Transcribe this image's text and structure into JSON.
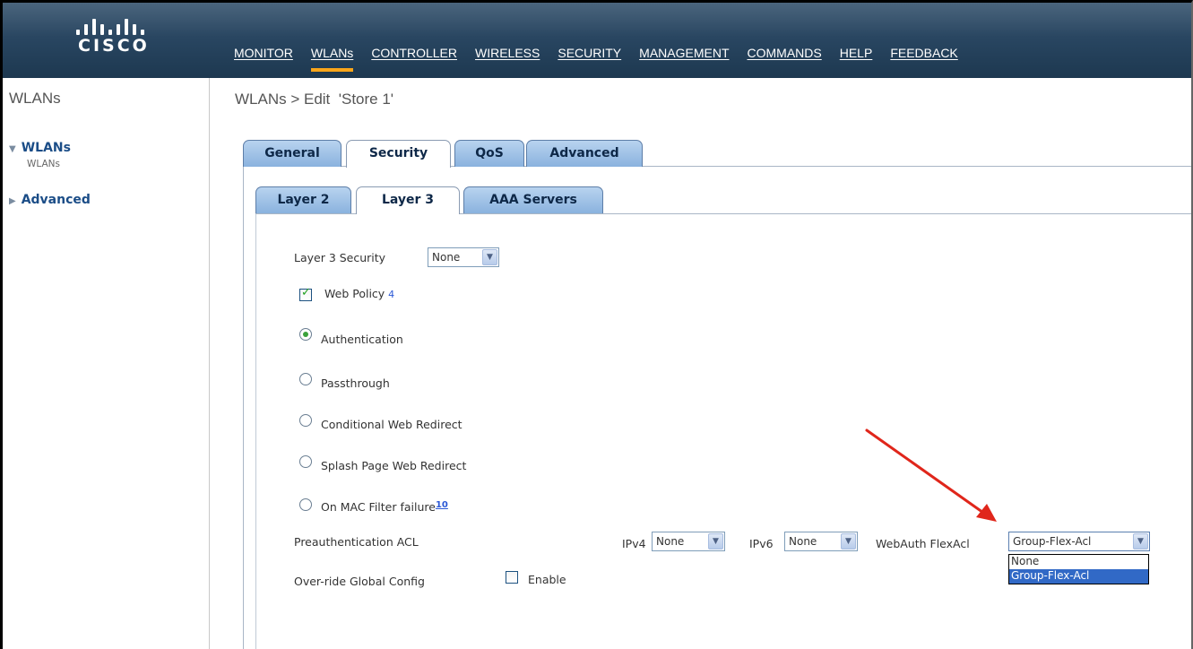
{
  "header": {
    "logo_text": "CISCO",
    "nav": [
      {
        "label": "MONITOR",
        "active": false
      },
      {
        "label": "WLANs",
        "active": true
      },
      {
        "label": "CONTROLLER",
        "active": false
      },
      {
        "label": "WIRELESS",
        "active": false
      },
      {
        "label": "SECURITY",
        "active": false
      },
      {
        "label": "MANAGEMENT",
        "active": false
      },
      {
        "label": "COMMANDS",
        "active": false
      },
      {
        "label": "HELP",
        "active": false
      },
      {
        "label": "FEEDBACK",
        "active": false
      }
    ]
  },
  "sidebar": {
    "title": "WLANs",
    "items": [
      {
        "label": "WLANs",
        "expanded": true,
        "sub": "WLANs"
      },
      {
        "label": "Advanced",
        "expanded": false
      }
    ]
  },
  "page": {
    "title": "WLANs > Edit  'Store 1'"
  },
  "tabs": {
    "main": [
      "General",
      "Security",
      "QoS",
      "Advanced"
    ],
    "main_active": "Security",
    "sub": [
      "Layer 2",
      "Layer 3",
      "AAA Servers"
    ],
    "sub_active": "Layer 3"
  },
  "form": {
    "layer3_security_label": "Layer 3 Security",
    "layer3_security_value": "None",
    "web_policy_label": "Web Policy",
    "web_policy_checked": true,
    "web_policy_marker": "4",
    "radios": [
      {
        "label": "Authentication",
        "checked": true
      },
      {
        "label": "Passthrough",
        "checked": false
      },
      {
        "label": "Conditional Web Redirect",
        "checked": false
      },
      {
        "label": "Splash Page Web Redirect",
        "checked": false
      },
      {
        "label": "On MAC Filter failure",
        "checked": false
      }
    ],
    "mac_filter_marker": "10",
    "preauth_label": "Preauthentication ACL",
    "ipv4_label": "IPv4",
    "ipv4_value": "None",
    "ipv6_label": "IPv6",
    "ipv6_value": "None",
    "webauth_label": "WebAuth FlexAcl",
    "webauth_value": "Group-Flex-Acl",
    "webauth_options": [
      "None",
      "Group-Flex-Acl"
    ],
    "webauth_selected_index": 1,
    "override_label": "Over-ride Global Config",
    "enable_label": "Enable",
    "enable_checked": false
  },
  "colors": {
    "header_bg": "#284560",
    "active_underline": "#f9a51a",
    "tab_blue": "#8ab2de",
    "annotation_arrow": "#e0261b"
  }
}
